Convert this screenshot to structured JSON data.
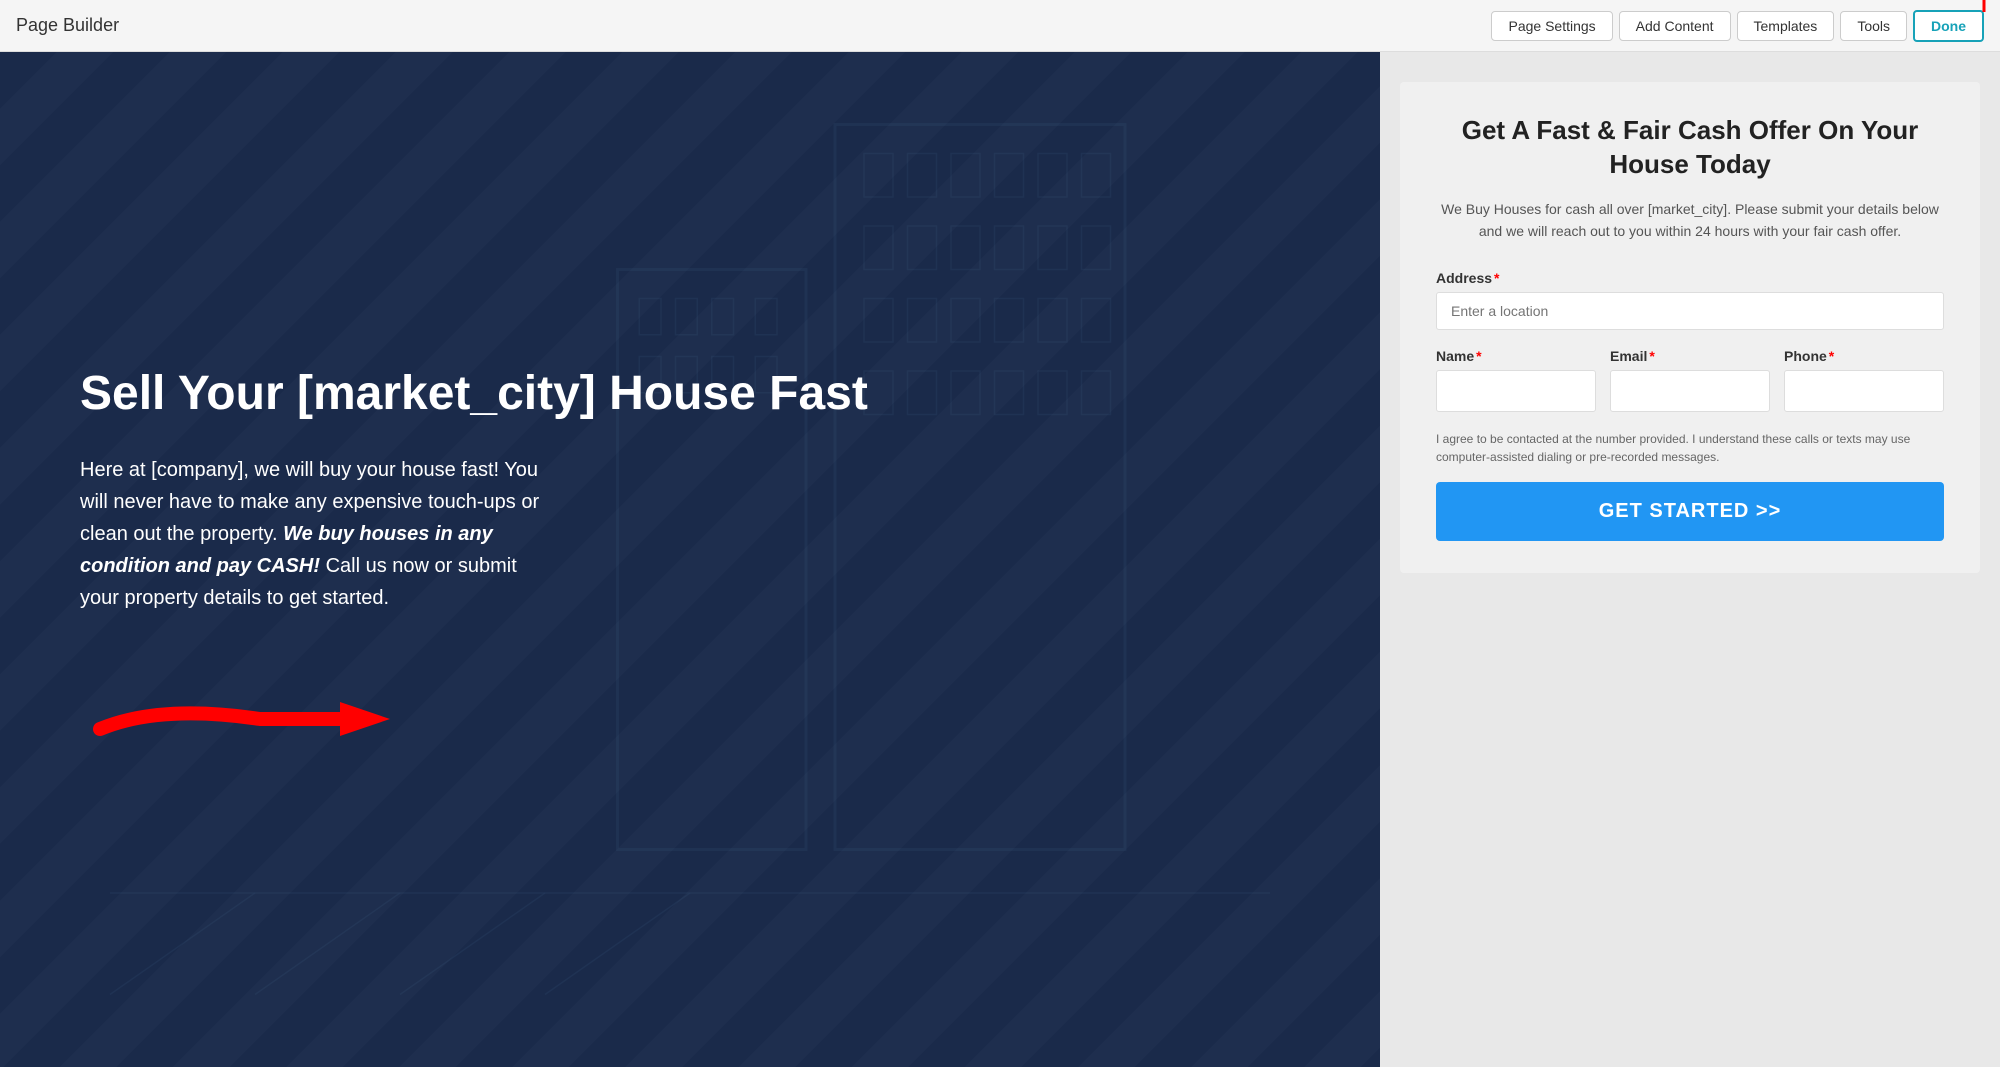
{
  "topbar": {
    "title": "Page Builder",
    "buttons": {
      "page_settings": "Page Settings",
      "add_content": "Add Content",
      "templates": "Templates",
      "tools": "Tools",
      "done": "Done"
    }
  },
  "left_panel": {
    "heading": "Sell Your [market_city] House Fast",
    "body_text": "Here at [company], we will buy your house fast! You will never have to make any expensive touch-ups or clean out the property.",
    "bold_text": "We buy houses in any condition and pay CASH!",
    "body_text2": "Call us now or submit your property details to get started."
  },
  "form": {
    "heading": "Get A Fast & Fair Cash Offer On Your House Today",
    "subtitle": "We Buy Houses for cash all over [market_city]. Please submit your details below and we will reach out to you within 24 hours with your fair cash offer.",
    "address_label": "Address",
    "address_placeholder": "Enter a location",
    "name_label": "Name",
    "email_label": "Email",
    "phone_label": "Phone",
    "consent_text": "I agree to be contacted at the number provided. I understand these calls or texts may use computer-assisted dialing or pre-recorded messages.",
    "submit_label": "GET STARTED >>"
  }
}
